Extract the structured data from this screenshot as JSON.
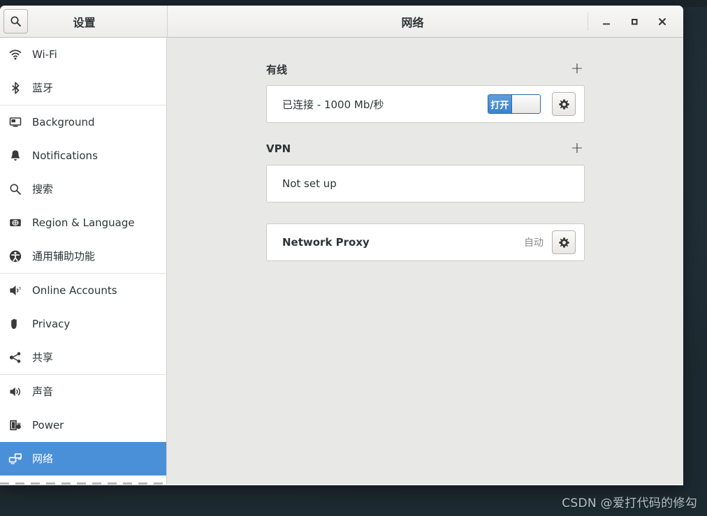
{
  "window": {
    "settings_title": "设置",
    "page_title": "网络",
    "search_icon": "search-icon",
    "controls": [
      {
        "name": "minimize",
        "glyph": "minimize-icon"
      },
      {
        "name": "maximize",
        "glyph": "maximize-icon"
      },
      {
        "name": "close",
        "glyph": "close-icon"
      }
    ]
  },
  "sidebar": {
    "selected_index": 12,
    "items": [
      {
        "label": "Wi-Fi",
        "icon": "wifi-icon"
      },
      {
        "label": "蓝牙",
        "icon": "bluetooth-icon"
      },
      {
        "label": "Background",
        "icon": "background-icon"
      },
      {
        "label": "Notifications",
        "icon": "bell-icon"
      },
      {
        "label": "搜索",
        "icon": "search-icon"
      },
      {
        "label": "Region & Language",
        "icon": "region-language-icon"
      },
      {
        "label": "通用辅助功能",
        "icon": "accessibility-icon"
      },
      {
        "label": "Online Accounts",
        "icon": "online-accounts-icon"
      },
      {
        "label": "Privacy",
        "icon": "privacy-hand-icon"
      },
      {
        "label": "共享",
        "icon": "share-icon"
      },
      {
        "label": "声音",
        "icon": "sound-icon"
      },
      {
        "label": "Power",
        "icon": "power-icon"
      },
      {
        "label": "网络",
        "icon": "network-icon"
      }
    ],
    "separator_after": [
      1,
      6,
      9,
      12
    ]
  },
  "content": {
    "wired": {
      "title": "有线",
      "add_label": "+",
      "status": "已连接 - 1000 Mb/秒",
      "toggle_on_label": "打开",
      "toggle_state": "on",
      "settings_icon": "gear-icon"
    },
    "vpn": {
      "title": "VPN",
      "add_label": "+",
      "status": "Not set up"
    },
    "proxy": {
      "title": "Network Proxy",
      "value": "自动",
      "settings_icon": "gear-icon"
    }
  },
  "watermark": {
    "text": "CSDN @爱打代码的修勾"
  },
  "colors": {
    "accent": "#4a90d9",
    "toggle_blue": "#3a82cc",
    "content_bg": "#e8e8e6",
    "titlebar_bg": "#f2f1f0",
    "desktop_bg": "#24323a"
  }
}
